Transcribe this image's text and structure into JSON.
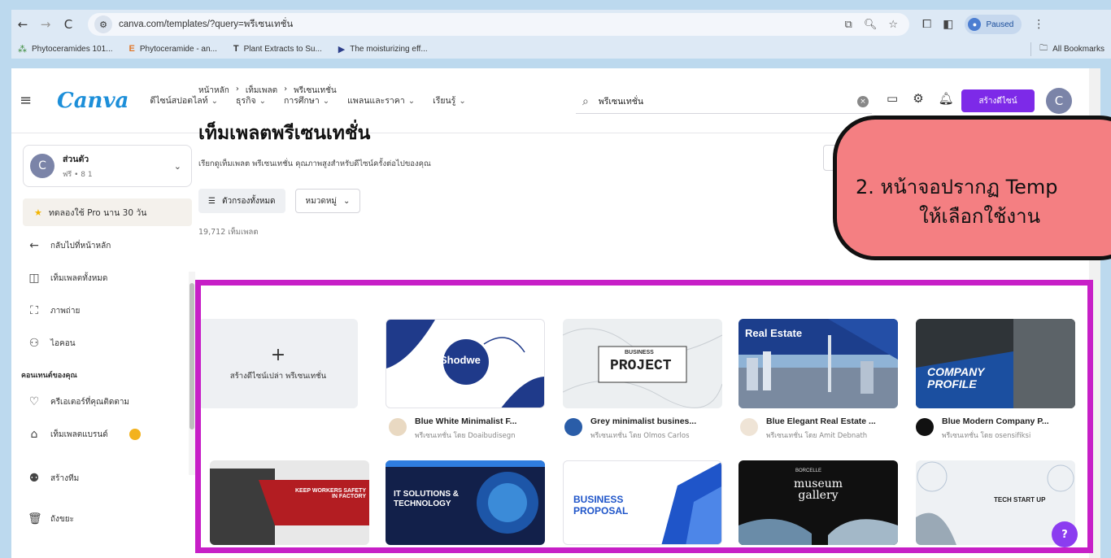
{
  "browser": {
    "url": "canva.com/templates/?query=พรีเซนเทชั่น",
    "paused": "Paused",
    "bookmarks": [
      "Phytoceramides 101...",
      "Phytoceramide - an...",
      "Plant Extracts to Su...",
      "The moisturizing eff..."
    ],
    "all_bookmarks": "All Bookmarks"
  },
  "header": {
    "logo": "Canva",
    "nav": [
      "ดีไซน์สปอตไลท์",
      "ธุรกิจ",
      "การศึกษา",
      "แพลนและราคา",
      "เรียนรู้"
    ],
    "search_value": "พรีเซนเทชั่น",
    "create_button": "สร้างดีไซน์",
    "avatar_letter": "C"
  },
  "sidebar": {
    "account_name": "ส่วนตัว",
    "account_sub": "ฟรี • 8 1",
    "pro_trial": "ทดลองใช้ Pro นาน 30 วัน",
    "back": "กลับไปที่หน้าหลัก",
    "items": [
      "เท็มเพลตทั้งหมด",
      "ภาพถ่าย",
      "ไอคอน"
    ],
    "section_heading": "คอนเทนต์ของคุณ",
    "section_items": [
      "ครีเอเตอร์ที่คุณติดตาม",
      "เท็มเพลตแบรนด์"
    ],
    "bottom_items": [
      "สร้างทีม",
      "ถังขยะ"
    ]
  },
  "main": {
    "breadcrumb": [
      "หน้าหลัก",
      "เท็มเพลต",
      "พรีเซนเทชั่น"
    ],
    "title": "เท็มเพลตพรีเซนเทชั่น",
    "subtitle": "เรียกดูเท็มเพลต พรีเซนเทชั่น คุณภาพสูงสำหรับดีไซน์ครั้งต่อไปของคุณ",
    "filter_all": "ตัวกรองทั้งหมด",
    "category": "หมวดหมู่",
    "count": "19,712 เท็มเพลต",
    "create_blank": "สร้างดีไซน์เปล่า พรีเซนเทชั่น",
    "templates": [
      {
        "title": "Blue White Minimalist F...",
        "by": "พรีเซนเทชั่น โดย Doaibudisegn",
        "thumb_text": "Shodwe"
      },
      {
        "title": "Grey minimalist busines...",
        "by": "พรีเซนเทชั่น โดย Olmos Carlos",
        "thumb_text": "PROJECT",
        "thumb_sub": "BUSINESS"
      },
      {
        "title": "Blue Elegant Real Estate ...",
        "by": "พรีเซนเทชั่น โดย Amit Debnath",
        "thumb_text": "Real Estate"
      },
      {
        "title": "Blue Modern Company P...",
        "by": "พรีเซนเทชั่น โดย osensifiksi",
        "thumb_text": "COMPANY PROFILE"
      }
    ],
    "row2": [
      {
        "thumb_text": "KEEP WORKERS SAFETY IN FACTORY"
      },
      {
        "thumb_text": "IT SOLUTIONS & TECHNOLOGY"
      },
      {
        "thumb_text": "BUSINESS PROPOSAL"
      },
      {
        "thumb_text": "museum gallery",
        "thumb_sub": "BORCELLE"
      },
      {
        "thumb_text": "TECH START UP"
      }
    ]
  },
  "callout": {
    "line1": "2. หน้าจอปรากฏ Temp",
    "line2": "ให้เลือกใช้งาน"
  },
  "help": "?"
}
